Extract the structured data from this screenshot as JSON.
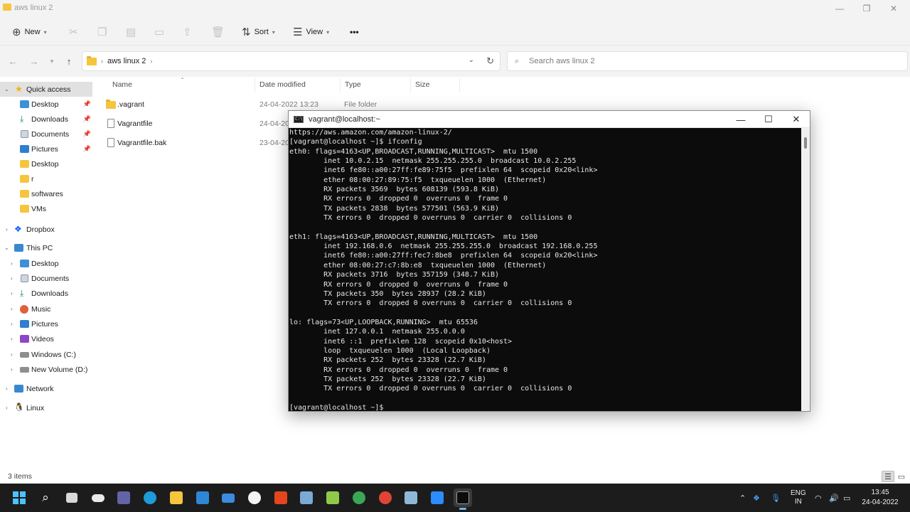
{
  "explorer": {
    "window_title": "aws linux 2",
    "toolbar": {
      "new_label": "New",
      "sort_label": "Sort",
      "view_label": "View",
      "more_label": "•••"
    },
    "address": {
      "path": "aws linux 2"
    },
    "search": {
      "placeholder": "Search aws linux 2"
    },
    "columns": {
      "name": "Name",
      "date": "Date modified",
      "type": "Type",
      "size": "Size"
    },
    "files": [
      {
        "name": ".vagrant",
        "date": "24-04-2022 13:23",
        "type": "File folder",
        "icon": "folder-icon"
      },
      {
        "name": "Vagrantfile",
        "date": "24-04-20",
        "type": "",
        "icon": "file-icon"
      },
      {
        "name": "Vagrantfile.bak",
        "date": "23-04-20",
        "type": "",
        "icon": "file-icon"
      }
    ],
    "nav": {
      "quick_access": "Quick access",
      "qa_items": [
        "Desktop",
        "Downloads",
        "Documents",
        "Pictures",
        "Desktop",
        "r",
        "softwares",
        "VMs"
      ],
      "dropbox": "Dropbox",
      "this_pc": "This PC",
      "pc_items": [
        "Desktop",
        "Documents",
        "Downloads",
        "Music",
        "Pictures",
        "Videos",
        "Windows (C:)",
        "New Volume (D:)"
      ],
      "network": "Network",
      "linux": "Linux"
    },
    "status": {
      "item_count": "3 items"
    }
  },
  "terminal": {
    "title": "vagrant@localhost:~",
    "lines": [
      "https://aws.amazon.com/amazon-linux-2/",
      "[vagrant@localhost ~]$ ifconfig",
      "eth0: flags=4163<UP,BROADCAST,RUNNING,MULTICAST>  mtu 1500",
      "        inet 10.0.2.15  netmask 255.255.255.0  broadcast 10.0.2.255",
      "        inet6 fe80::a00:27ff:fe89:75f5  prefixlen 64  scopeid 0x20<link>",
      "        ether 08:00:27:89:75:f5  txqueuelen 1000  (Ethernet)",
      "        RX packets 3569  bytes 608139 (593.8 KiB)",
      "        RX errors 0  dropped 0  overruns 0  frame 0",
      "        TX packets 2838  bytes 577501 (563.9 KiB)",
      "        TX errors 0  dropped 0 overruns 0  carrier 0  collisions 0",
      "",
      "eth1: flags=4163<UP,BROADCAST,RUNNING,MULTICAST>  mtu 1500",
      "        inet 192.168.0.6  netmask 255.255.255.0  broadcast 192.168.0.255",
      "        inet6 fe80::a00:27ff:fec7:8be8  prefixlen 64  scopeid 0x20<link>",
      "        ether 08:00:27:c7:8b:e8  txqueuelen 1000  (Ethernet)",
      "        RX packets 3716  bytes 357159 (348.7 KiB)",
      "        RX errors 0  dropped 0  overruns 0  frame 0",
      "        TX packets 350  bytes 28937 (28.2 KiB)",
      "        TX errors 0  dropped 0 overruns 0  carrier 0  collisions 0",
      "",
      "lo: flags=73<UP,LOOPBACK,RUNNING>  mtu 65536",
      "        inet 127.0.0.1  netmask 255.0.0.0",
      "        inet6 ::1  prefixlen 128  scopeid 0x10<host>",
      "        loop  txqueuelen 1000  (Local Loopback)",
      "        RX packets 252  bytes 23328 (22.7 KiB)",
      "        RX errors 0  dropped 0  overruns 0  frame 0",
      "        TX packets 252  bytes 23328 (22.7 KiB)",
      "        TX errors 0  dropped 0 overruns 0  carrier 0  collisions 0",
      "",
      "[vagrant@localhost ~]$ "
    ]
  },
  "taskbar": {
    "language": "ENG",
    "region": "IN",
    "time": "13:45",
    "date": "24-04-2022"
  }
}
